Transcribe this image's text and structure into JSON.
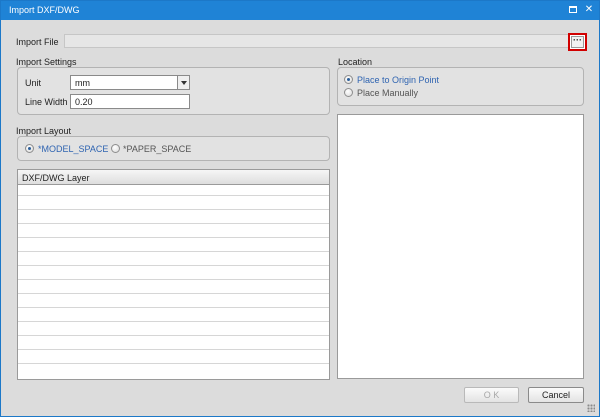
{
  "window": {
    "title": "Import DXF/DWG",
    "maximize_icon": "maximize-icon",
    "close_icon": "close-icon",
    "close_glyph": "✕",
    "accent": "#1f83d6"
  },
  "import_file": {
    "label": "Import File",
    "value": "",
    "browse_label": "···",
    "highlight": "#d10000"
  },
  "import_settings": {
    "heading": "Import Settings",
    "unit_label": "Unit",
    "unit_value": "mm",
    "line_width_label": "Line Width",
    "line_width_value": "0.20"
  },
  "import_layout": {
    "heading": "Import Layout",
    "options": [
      {
        "label": "*MODEL_SPACE",
        "checked": true
      },
      {
        "label": "*PAPER_SPACE",
        "checked": false
      }
    ]
  },
  "layer_table": {
    "header": "DXF/DWG Layer",
    "rows": []
  },
  "location": {
    "heading": "Location",
    "options": [
      {
        "label": "Place to Origin Point",
        "checked": true
      },
      {
        "label": "Place Manually",
        "checked": false
      }
    ]
  },
  "footer": {
    "ok_label": "O K",
    "cancel_label": "Cancel"
  }
}
